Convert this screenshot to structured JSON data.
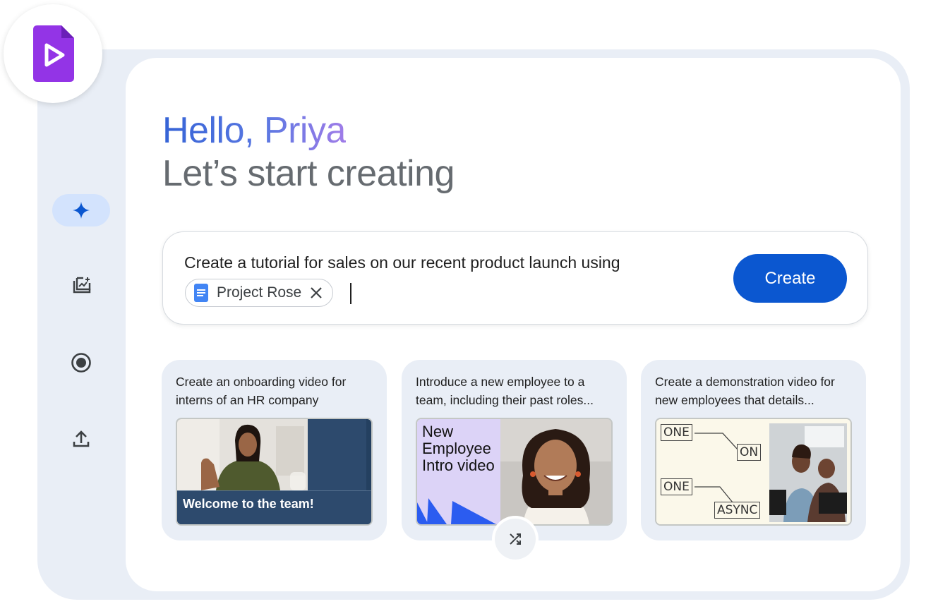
{
  "greeting": "Hello, Priya",
  "subtitle": "Let’s start creating",
  "app": {
    "icon": "vids-play-icon"
  },
  "rail": {
    "items": [
      {
        "name": "sparkle-icon",
        "active": true
      },
      {
        "name": "templates-icon",
        "active": false
      },
      {
        "name": "record-icon",
        "active": false
      },
      {
        "name": "upload-icon",
        "active": false
      }
    ]
  },
  "prompt": {
    "text": "Create a tutorial for sales on our recent product launch using",
    "chip_label": "Project Rose",
    "create_label": "Create"
  },
  "suggestions": [
    {
      "text": "Create an onboarding video for interns of an HR company",
      "thumb_caption": "Welcome to the team!"
    },
    {
      "text": "Introduce a new employee to a team, including their past roles...",
      "thumb_caption": "New Employee Intro video"
    },
    {
      "text": "Create a demonstration video for new employees that details...",
      "thumb_labels": [
        "ONE",
        "ON",
        "ONE",
        "ASYNC"
      ]
    }
  ],
  "colors": {
    "accent": "#0b57d0",
    "rail_active": "#d3e3fd",
    "frame": "#e9eef6",
    "vids_purple": "#9334e6"
  }
}
